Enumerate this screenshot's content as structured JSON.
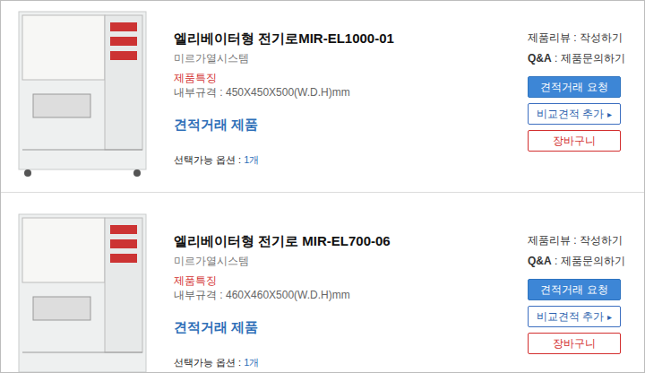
{
  "products": [
    {
      "title": "엘리베이터형 전기로MIR-EL1000-01",
      "brand": "미르가열시스템",
      "feature_label": "제품특징",
      "spec": "내부규격 : 450X450X500(W.D.H)mm",
      "deal_label": "견적거래 제품",
      "options_label": "선택가능 옵션 : ",
      "options_count": "1개",
      "review_label": "제품리뷰 : ",
      "review_action": "작성하기",
      "qa_label": "Q&A",
      "qa_sep": " : ",
      "qa_action": "제품문의하기",
      "buttons": [
        {
          "label": "견적거래 요청",
          "kind": "primary",
          "arrow": ""
        },
        {
          "label": "비교견적 추가",
          "kind": "outline",
          "arrow": "▸"
        },
        {
          "label": "장바구니",
          "kind": "danger",
          "arrow": ""
        }
      ]
    },
    {
      "title": "엘리베이터형 전기로 MIR-EL700-06",
      "brand": "미르가열시스템",
      "feature_label": "제품특징",
      "spec": "내부규격 : 460X460X500(W.D.H)mm",
      "deal_label": "견적거래 제품",
      "options_label": "선택가능 옵션 : ",
      "options_count": "1개",
      "review_label": "제품리뷰 : ",
      "review_action": "작성하기",
      "qa_label": "Q&A",
      "qa_sep": " : ",
      "qa_action": "제품문의하기",
      "buttons": [
        {
          "label": "견적거래 요청",
          "kind": "primary",
          "arrow": ""
        },
        {
          "label": "비교견적 추가",
          "kind": "outline",
          "arrow": "▸"
        },
        {
          "label": "장바구니",
          "kind": "danger",
          "arrow": ""
        }
      ]
    }
  ]
}
